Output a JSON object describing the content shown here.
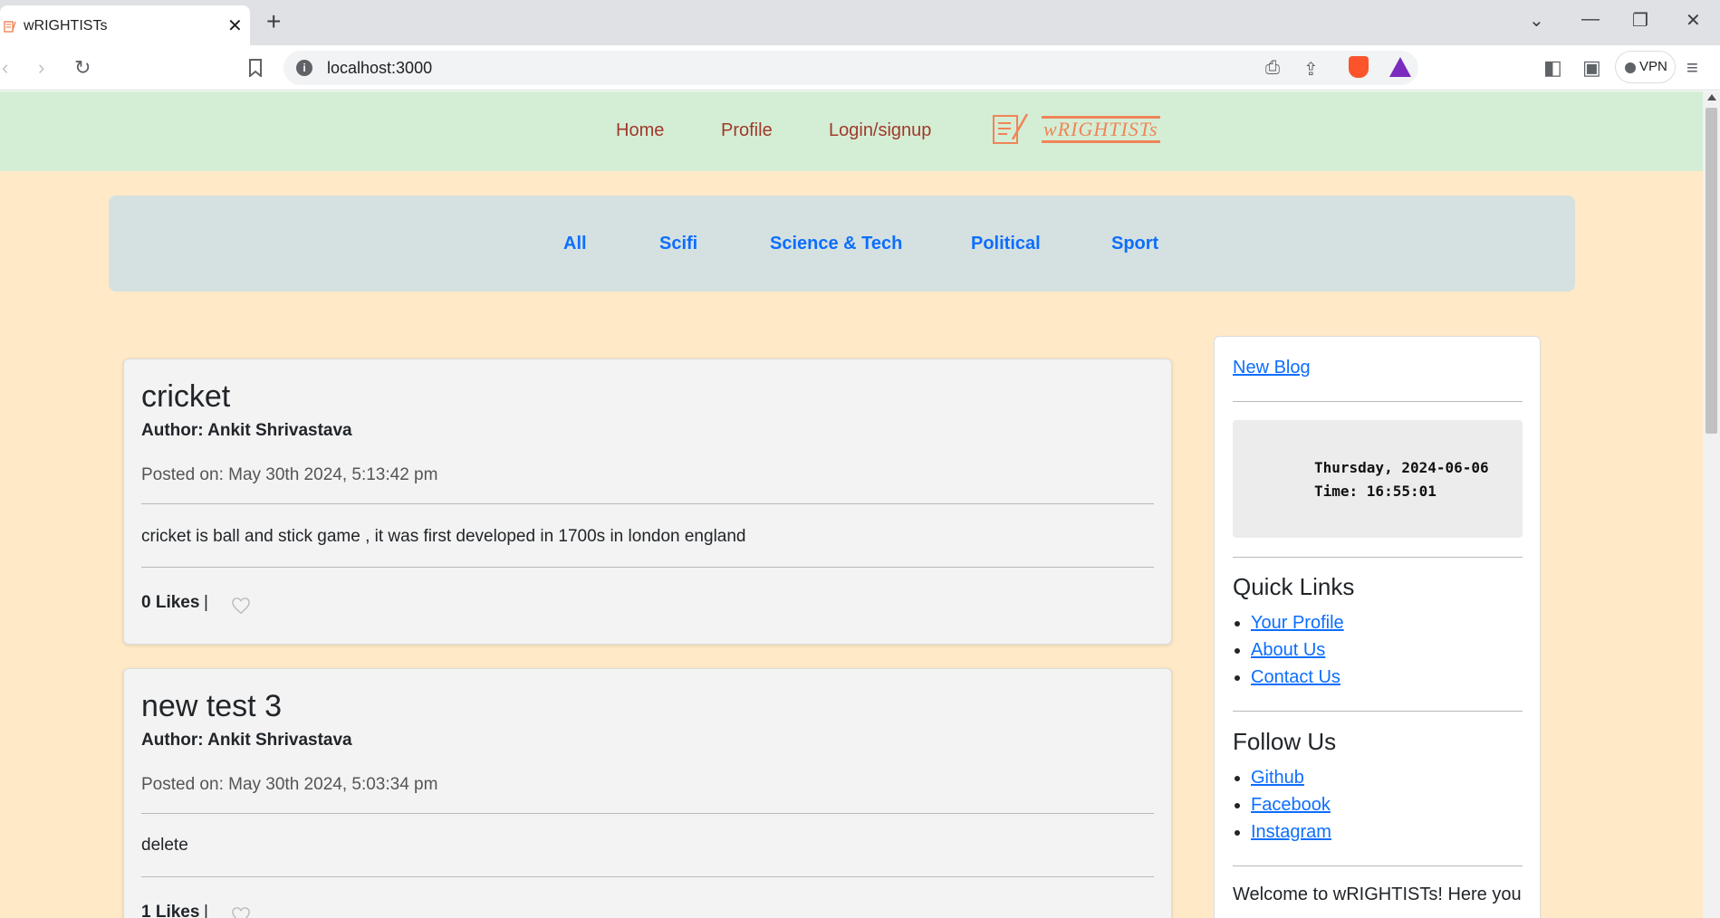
{
  "browser": {
    "tab_title": "wRIGHTISTs",
    "url": "localhost:3000",
    "vpn_label": "VPN",
    "accent_colors": {
      "brave": "#fb542b",
      "rewards": "#7b2cbf"
    }
  },
  "site": {
    "nav": [
      {
        "label": "Home"
      },
      {
        "label": "Profile"
      },
      {
        "label": "Login/signup"
      }
    ],
    "logo_text": "wRIGHTISTs",
    "colors": {
      "nav_bg": "#d4eed5",
      "page_bg": "#ffe9c7",
      "link": "#0d6efd",
      "nav_link": "#a0392b"
    }
  },
  "categories": [
    {
      "label": "All"
    },
    {
      "label": "Scifi"
    },
    {
      "label": "Science & Tech"
    },
    {
      "label": "Political"
    },
    {
      "label": "Sport"
    }
  ],
  "posts": [
    {
      "title": "cricket",
      "author": "Author: Ankit Shrivastava",
      "date": "Posted on: May 30th 2024, 5:13:42 pm",
      "body": "cricket is ball and stick game , it was first developed in 1700s in london england",
      "likes": "0 Likes",
      "sep": "|"
    },
    {
      "title": "new test 3",
      "author": "Author: Ankit Shrivastava",
      "date": "Posted on: May 30th 2024, 5:03:34 pm",
      "body": "delete",
      "likes": "1 Likes",
      "sep": "|"
    }
  ],
  "sidebar": {
    "new_blog": "New Blog",
    "clock_date": "Thursday, 2024-06-06",
    "clock_time": "Time: 16:55:01",
    "quick_links_title": "Quick Links",
    "quick_links": [
      {
        "label": "Your Profile"
      },
      {
        "label": "About Us"
      },
      {
        "label": "Contact Us"
      }
    ],
    "follow_title": "Follow Us",
    "follow_links": [
      {
        "label": "Github"
      },
      {
        "label": "Facebook"
      },
      {
        "label": "Instagram"
      }
    ],
    "welcome": "Welcome to wRIGHTISTs! Here you"
  }
}
